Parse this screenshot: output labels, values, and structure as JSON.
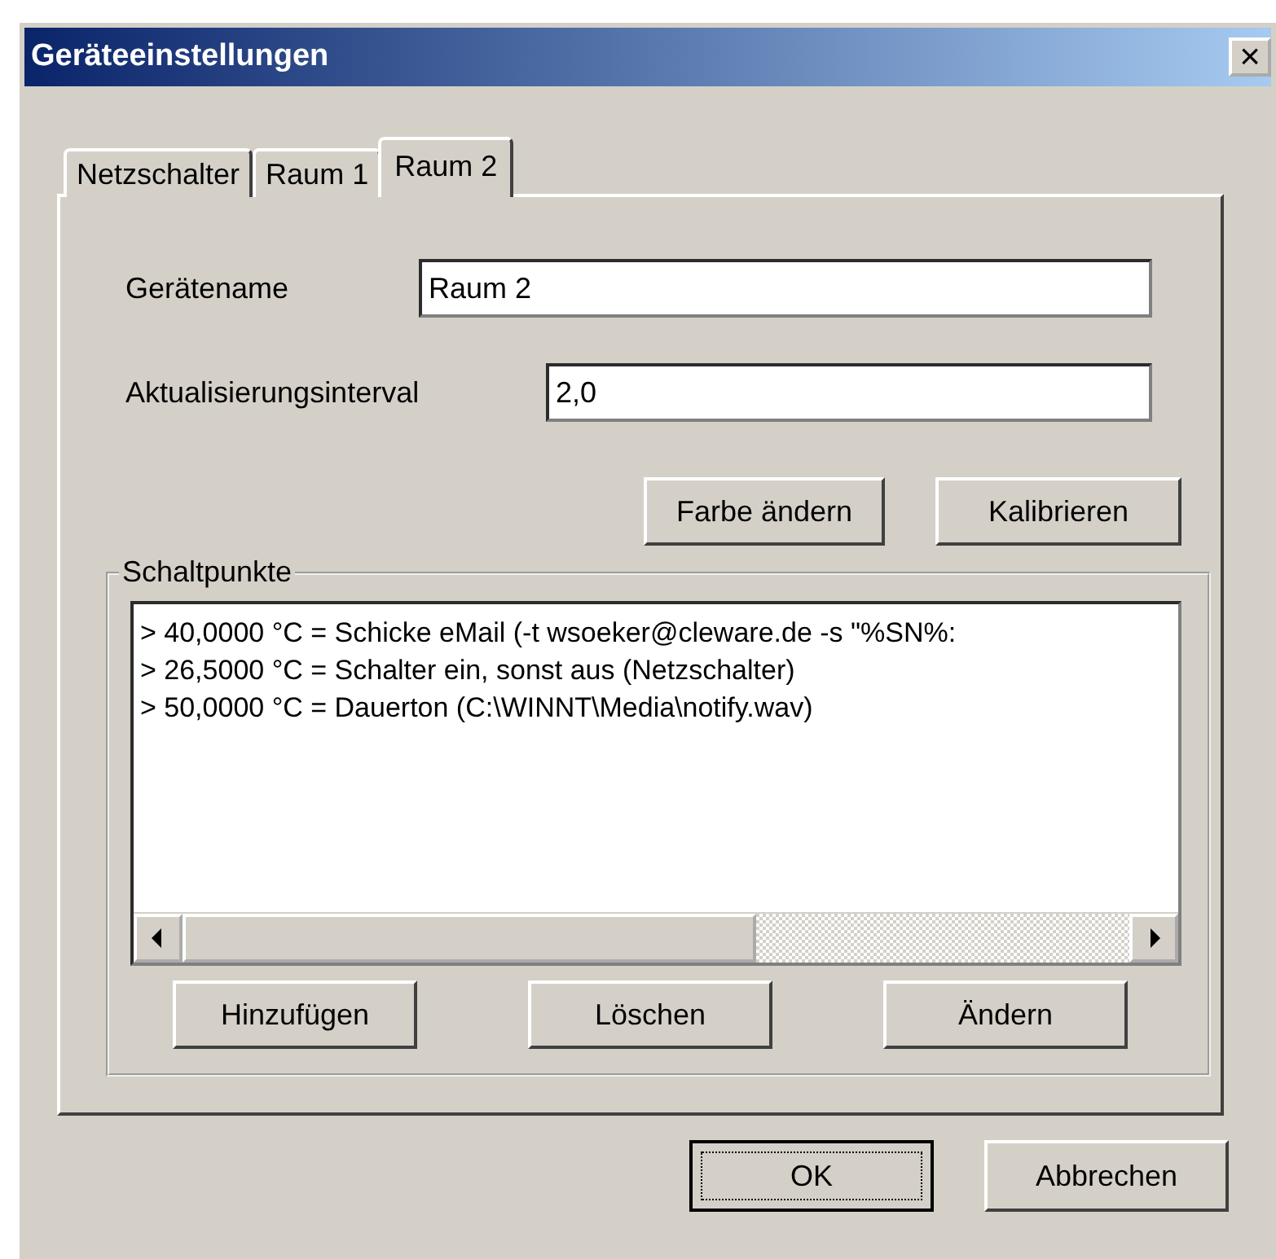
{
  "window": {
    "title": "Geräteeinstellungen",
    "close": "×"
  },
  "tabs": [
    {
      "label": "Netzschalter",
      "selected": false
    },
    {
      "label": "Raum 1",
      "selected": false
    },
    {
      "label": "Raum 2",
      "selected": true
    }
  ],
  "fields": [
    {
      "label": "Gerätename",
      "value": "Raum 2"
    },
    {
      "label": "Aktualisierungsinterval",
      "value": "2,0"
    }
  ],
  "panel_buttons": [
    "Farbe ändern",
    "Kalibrieren"
  ],
  "group": {
    "title": "Schaltpunkte",
    "items": [
      "> 40,0000 °C = Schicke eMail (-t wsoeker@cleware.de -s \"%SN%:",
      "> 26,5000 °C = Schalter ein, sonst aus (Netzschalter)",
      "> 50,0000 °C = Dauerton (C:\\WINNT\\Media\\notify.wav)"
    ],
    "buttons": [
      "Hinzufügen",
      "Löschen",
      "Ändern"
    ]
  },
  "buttons": [
    {
      "label": "OK",
      "default": true
    },
    {
      "label": "Abbrechen",
      "default": false
    }
  ]
}
